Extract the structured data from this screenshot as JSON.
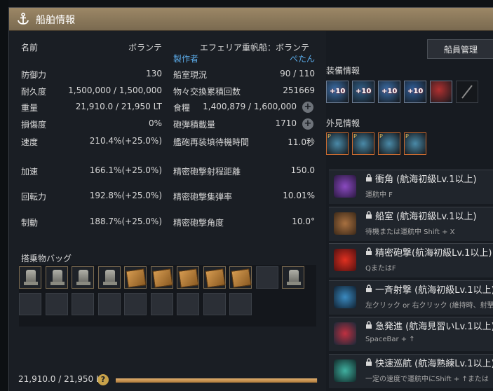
{
  "window": {
    "title": "船舶情報",
    "anchor_icon": "anchor-icon"
  },
  "ship": {
    "name_label": "名前",
    "name_value": "ボランテ",
    "full_name": "エフェリア重帆船：ボランテ",
    "maker_label": "製作者",
    "maker_value": "ぺたん"
  },
  "stats_left": [
    {
      "label": "防御力",
      "value": "130"
    },
    {
      "label": "耐久度",
      "value": "1,500,000 / 1,500,000"
    },
    {
      "label": "重量",
      "value": "21,910.0 / 21,950 LT"
    },
    {
      "label": "損傷度",
      "value": "0%"
    },
    {
      "label": "速度",
      "value": "210.4%(+25.0%)"
    },
    {
      "label": "加速",
      "value": "166.1%(+25.0%)"
    },
    {
      "label": "回転力",
      "value": "192.8%(+25.0%)"
    },
    {
      "label": "制動",
      "value": "188.7%(+25.0%)"
    }
  ],
  "stats_right": [
    {
      "label": "船室現況",
      "value": "90 / 110"
    },
    {
      "label": "物々交換累積回数",
      "value": "251669"
    },
    {
      "label": "食糧",
      "value": "1,400,879 / 1,600,000"
    },
    {
      "label": "砲弾積載量",
      "value": "1710"
    },
    {
      "label": "艦砲再装填待機時間",
      "value": "11.0秒"
    },
    {
      "label": "精密砲撃射程距離",
      "value": "150.0"
    },
    {
      "label": "精密砲撃集弾率",
      "value": "10.01%"
    },
    {
      "label": "精密砲撃角度",
      "value": "10.0°"
    }
  ],
  "bag": {
    "title": "搭乗物バッグ",
    "row1": [
      "tower",
      "tower",
      "tower",
      "tower",
      "crate",
      "crate",
      "crate",
      "crate",
      "crate",
      "empty",
      "tower"
    ],
    "row2_count": 9,
    "weight_text": "21,910.0 / 21,950 LT",
    "weight_fraction": 0.998
  },
  "crew_button": "船員管理",
  "equipment": {
    "title": "装備情報",
    "slots": [
      {
        "icon": "bow-ornament-icon",
        "badge": "+10"
      },
      {
        "icon": "cannon-icon",
        "badge": "+10"
      },
      {
        "icon": "plating-icon",
        "badge": "+10"
      },
      {
        "icon": "sail-icon",
        "badge": "+10"
      },
      {
        "icon": "crew-emblem-icon",
        "badge": ""
      },
      {
        "icon": "empty-slot-icon",
        "badge": ""
      }
    ]
  },
  "appearance": {
    "title": "外見情報",
    "slots": [
      {
        "icon": "hull-skin-icon",
        "badge": "P"
      },
      {
        "icon": "figurehead-skin-icon",
        "badge": "P"
      },
      {
        "icon": "cannon-skin-icon",
        "badge": "P"
      },
      {
        "icon": "sail-skin-icon",
        "badge": "P"
      }
    ]
  },
  "skills": [
    {
      "name": "衝角 (航海初級Lv.1以上)",
      "desc": "運航中 F",
      "icon": "ram-skill-icon"
    },
    {
      "name": "船室 (航海初級Lv.1以上)",
      "desc": "待機または運航中 Shift + X",
      "icon": "cabin-skill-icon"
    },
    {
      "name": "精密砲撃(航海初級Lv.1以上)",
      "desc": "QまたはF",
      "icon": "precision-shot-skill-icon"
    },
    {
      "name": "一斉射撃 (航海初級Lv.1以上)",
      "desc": "左クリック or 右クリック (維持時、射撃",
      "icon": "broadside-skill-icon"
    },
    {
      "name": "急発進 (航海見習いLv.1以上)",
      "desc": "SpaceBar + ↑",
      "icon": "sudden-start-skill-icon"
    },
    {
      "name": "快速巡航 (航海熟練Lv.1以上)",
      "desc": "一定の速度で運航中にShift + ↑または",
      "icon": "fast-cruise-skill-icon"
    }
  ],
  "colors": {
    "accent": "#9c8766",
    "highlight_blue": "#5aa9e6",
    "panel": "#1a1e24"
  }
}
